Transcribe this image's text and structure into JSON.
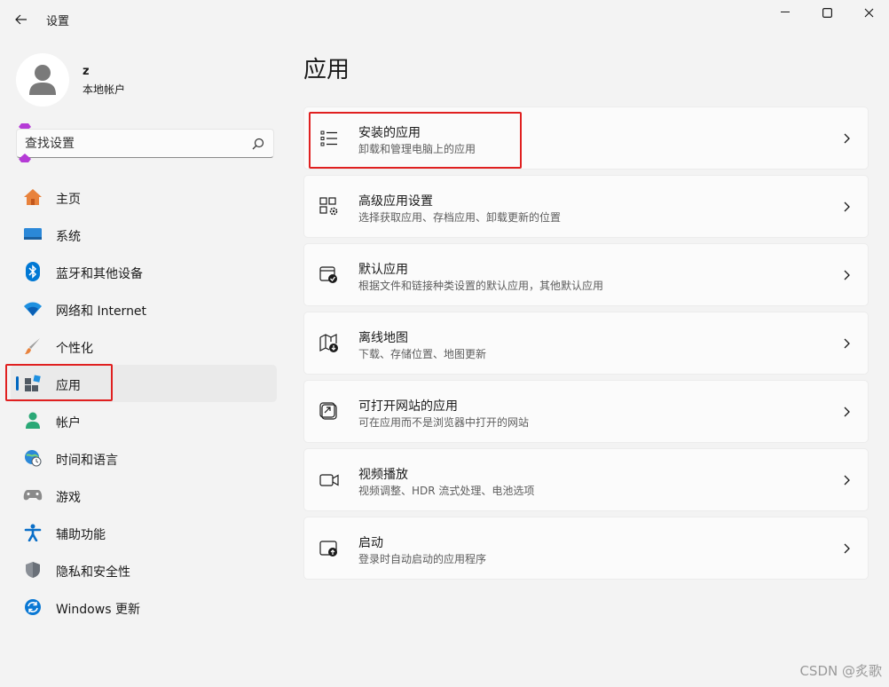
{
  "window": {
    "title": "设置"
  },
  "user": {
    "name": "z",
    "account_type": "本地帐户"
  },
  "search": {
    "placeholder": "查找设置"
  },
  "sidebar": {
    "items": [
      {
        "label": "主页",
        "icon": "home-icon"
      },
      {
        "label": "系统",
        "icon": "system-icon"
      },
      {
        "label": "蓝牙和其他设备",
        "icon": "bluetooth-icon"
      },
      {
        "label": "网络和 Internet",
        "icon": "wifi-icon"
      },
      {
        "label": "个性化",
        "icon": "brush-icon"
      },
      {
        "label": "应用",
        "icon": "apps-icon",
        "selected": true
      },
      {
        "label": "帐户",
        "icon": "account-icon"
      },
      {
        "label": "时间和语言",
        "icon": "globe-clock-icon"
      },
      {
        "label": "游戏",
        "icon": "gamepad-icon"
      },
      {
        "label": "辅助功能",
        "icon": "accessibility-icon"
      },
      {
        "label": "隐私和安全性",
        "icon": "shield-icon"
      },
      {
        "label": "Windows 更新",
        "icon": "update-icon"
      }
    ]
  },
  "main": {
    "title": "应用",
    "cards": [
      {
        "title": "安装的应用",
        "description": "卸载和管理电脑上的应用",
        "icon": "list-icon"
      },
      {
        "title": "高级应用设置",
        "description": "选择获取应用、存档应用、卸载更新的位置",
        "icon": "app-settings-icon"
      },
      {
        "title": "默认应用",
        "description": "根据文件和链接种类设置的默认应用，其他默认应用",
        "icon": "default-apps-icon"
      },
      {
        "title": "离线地图",
        "description": "下载、存储位置、地图更新",
        "icon": "offline-map-icon"
      },
      {
        "title": "可打开网站的应用",
        "description": "可在应用而不是浏览器中打开的网站",
        "icon": "open-link-icon"
      },
      {
        "title": "视频播放",
        "description": "视频调整、HDR 流式处理、电池选项",
        "icon": "video-icon"
      },
      {
        "title": "启动",
        "description": "登录时自动启动的应用程序",
        "icon": "startup-icon"
      }
    ]
  },
  "watermark": "CSDN @炙歌",
  "colors": {
    "accent": "#0067c0",
    "highlight": "#e02020",
    "background": "#f3f3f3",
    "card": "#fbfbfb"
  }
}
